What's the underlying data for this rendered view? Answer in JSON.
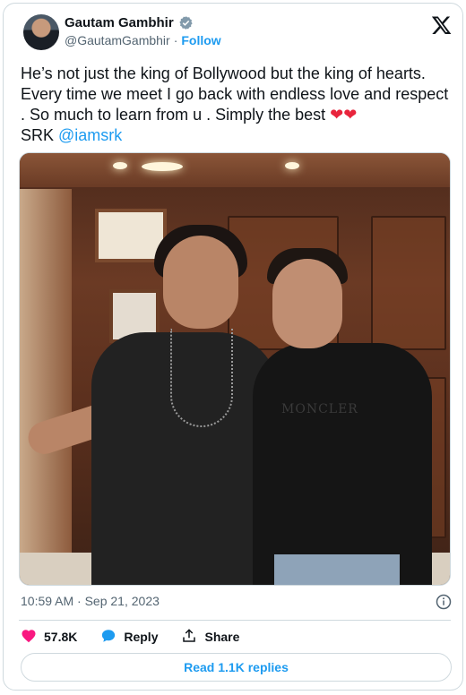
{
  "author": {
    "display_name": "Gautam Gambhir",
    "handle": "@GautamGambhir",
    "separator": "·",
    "follow_label": "Follow"
  },
  "tweet": {
    "text_main": "He’s not just the king of Bollywood but the king of hearts. Every time we meet I go back with endless love and respect . So much to learn from u . Simply the best ",
    "hearts": "❤❤",
    "text_after_hearts": "\nSRK ",
    "mention": "@iamsrk",
    "photo_shirt_text": "MONCLER"
  },
  "meta": {
    "timestamp": "10:59 AM · Sep 21, 2023"
  },
  "actions": {
    "likes_count": "57.8K",
    "reply_label": "Reply",
    "share_label": "Share",
    "read_replies_label": "Read 1.1K replies"
  },
  "colors": {
    "accent": "#1d9bf0",
    "like": "#f91880",
    "text": "#0f1419",
    "muted": "#536471"
  },
  "icons": {
    "verified": "verified-badge-icon",
    "platform": "x-logo-icon",
    "info": "info-icon",
    "like": "heart-icon",
    "reply": "reply-bubble-icon",
    "share": "share-icon"
  }
}
